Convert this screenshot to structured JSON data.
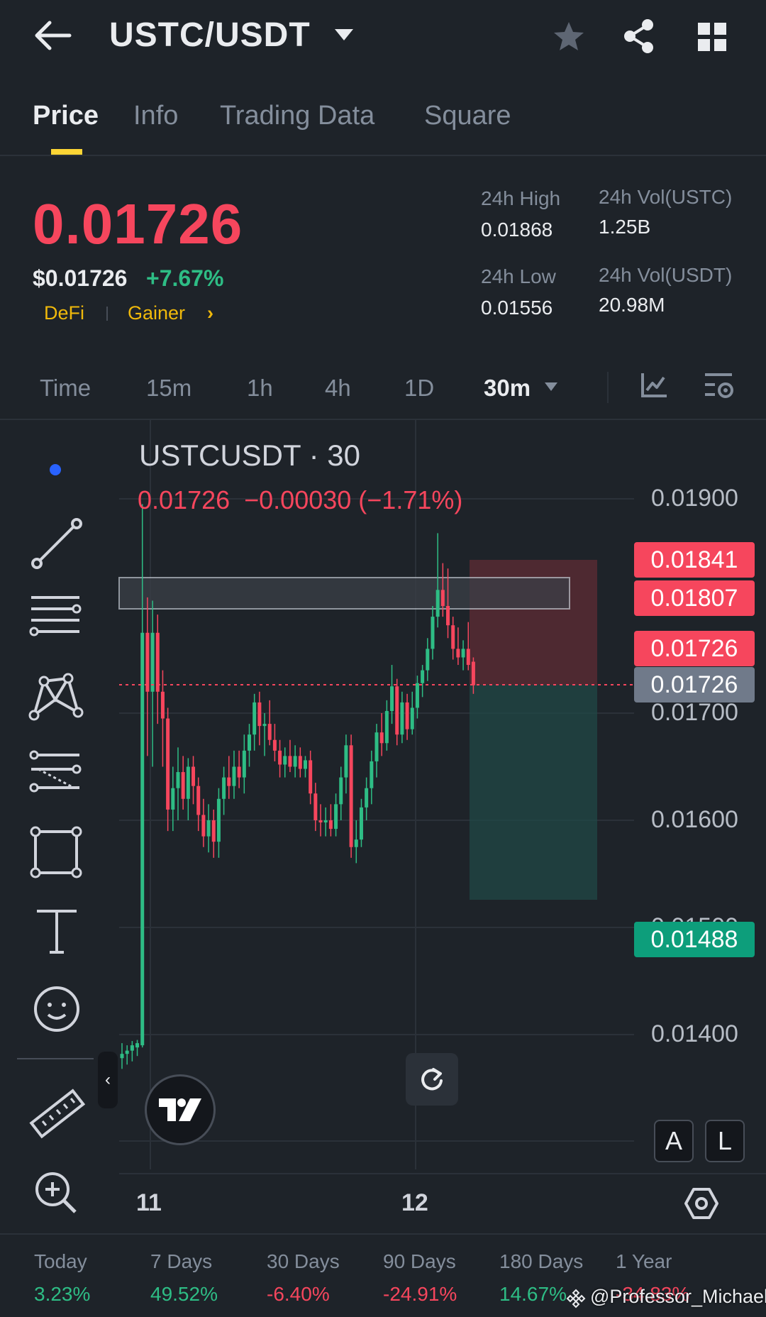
{
  "header": {
    "pair": "USTC/USDT",
    "icons": [
      "back-arrow-icon",
      "caret-down-icon",
      "star-icon",
      "share-icon",
      "grid-icon"
    ]
  },
  "tabs": [
    {
      "label": "Price",
      "active": true
    },
    {
      "label": "Info",
      "active": false
    },
    {
      "label": "Trading Data",
      "active": false
    },
    {
      "label": "Square",
      "active": false
    }
  ],
  "price": {
    "last": "0.01726",
    "usd": "$0.01726",
    "change": "+7.67%",
    "tags": [
      "DeFi",
      "Gainer"
    ],
    "gainer_chevron": "›"
  },
  "stats": {
    "high_label": "24h High",
    "high_value": "0.01868",
    "low_label": "24h Low",
    "low_value": "0.01556",
    "vol_base_label": "24h Vol(USTC)",
    "vol_base_value": "1.25B",
    "vol_quote_label": "24h Vol(USDT)",
    "vol_quote_value": "20.98M"
  },
  "intervals": [
    {
      "label": "Time",
      "active": false
    },
    {
      "label": "15m",
      "active": false
    },
    {
      "label": "1h",
      "active": false
    },
    {
      "label": "4h",
      "active": false
    },
    {
      "label": "1D",
      "active": false
    },
    {
      "label": "30m",
      "active": true
    }
  ],
  "chart": {
    "symbol_title": "USTCUSDT · 30",
    "ohlc_line": "0.01726  −0.00030 (−1.71%)",
    "axis_labels": [
      "0.01900",
      "0.01700",
      "0.01600",
      "0.01500",
      "0.01400"
    ],
    "price_tags": [
      {
        "value": "0.01841",
        "color": "#f6465d"
      },
      {
        "value": "0.01807",
        "color": "#f6465d"
      },
      {
        "value": "0.01726",
        "color": "#f6465d"
      },
      {
        "value": "0.01726",
        "color": "#707a8a"
      },
      {
        "value": "0.01488",
        "color": "#0d9e7b"
      }
    ],
    "dates": [
      "11",
      "12"
    ],
    "scale_buttons": [
      "A",
      "L"
    ],
    "collapse_glyph": "‹",
    "colors": {
      "up": "#2ebd85",
      "down": "#f6465d"
    }
  },
  "chart_data": {
    "type": "candlestick",
    "symbol": "USTCUSDT",
    "interval": "30",
    "y_axis_ticks": [
      0.019,
      0.017,
      0.016,
      0.015,
      0.014
    ],
    "ylim": [
      0.0133,
      0.0198
    ],
    "x_tick_labels": [
      "11",
      "12"
    ],
    "last_price": 0.01726,
    "change": -0.0003,
    "change_percent": -1.71,
    "position_tool": {
      "entry": 0.01726,
      "stop": 0.01841,
      "target": 0.01488
    },
    "marked_levels": [
      0.01841,
      0.01807,
      0.01726
    ],
    "candles": [
      {
        "o": 0.01378,
        "h": 0.01392,
        "l": 0.01368,
        "c": 0.01382
      },
      {
        "o": 0.01382,
        "h": 0.0139,
        "l": 0.01372,
        "c": 0.01385
      },
      {
        "o": 0.01385,
        "h": 0.01394,
        "l": 0.01375,
        "c": 0.0139
      },
      {
        "o": 0.01388,
        "h": 0.01395,
        "l": 0.0138,
        "c": 0.01392
      },
      {
        "o": 0.0139,
        "h": 0.01895,
        "l": 0.01388,
        "c": 0.01775
      },
      {
        "o": 0.01775,
        "h": 0.01808,
        "l": 0.0166,
        "c": 0.0172
      },
      {
        "o": 0.0172,
        "h": 0.01805,
        "l": 0.0165,
        "c": 0.01775
      },
      {
        "o": 0.01775,
        "h": 0.01792,
        "l": 0.0169,
        "c": 0.0172
      },
      {
        "o": 0.0172,
        "h": 0.0174,
        "l": 0.0165,
        "c": 0.01695
      },
      {
        "o": 0.01695,
        "h": 0.01705,
        "l": 0.0159,
        "c": 0.0161
      },
      {
        "o": 0.0161,
        "h": 0.0165,
        "l": 0.0159,
        "c": 0.0163
      },
      {
        "o": 0.0163,
        "h": 0.01668,
        "l": 0.016,
        "c": 0.01645
      },
      {
        "o": 0.01645,
        "h": 0.0166,
        "l": 0.0161,
        "c": 0.0162
      },
      {
        "o": 0.0162,
        "h": 0.01658,
        "l": 0.016,
        "c": 0.0165
      },
      {
        "o": 0.0165,
        "h": 0.0166,
        "l": 0.01615,
        "c": 0.01632
      },
      {
        "o": 0.01632,
        "h": 0.0164,
        "l": 0.0159,
        "c": 0.01605
      },
      {
        "o": 0.01605,
        "h": 0.0162,
        "l": 0.01575,
        "c": 0.01585
      },
      {
        "o": 0.01585,
        "h": 0.01615,
        "l": 0.0157,
        "c": 0.016
      },
      {
        "o": 0.016,
        "h": 0.0161,
        "l": 0.01565,
        "c": 0.0158
      },
      {
        "o": 0.0158,
        "h": 0.0163,
        "l": 0.01565,
        "c": 0.0162
      },
      {
        "o": 0.0162,
        "h": 0.0165,
        "l": 0.01605,
        "c": 0.0164
      },
      {
        "o": 0.0164,
        "h": 0.0166,
        "l": 0.0162,
        "c": 0.01632
      },
      {
        "o": 0.01632,
        "h": 0.01665,
        "l": 0.0162,
        "c": 0.0165
      },
      {
        "o": 0.0165,
        "h": 0.01665,
        "l": 0.0163,
        "c": 0.0164
      },
      {
        "o": 0.0164,
        "h": 0.0168,
        "l": 0.01625,
        "c": 0.01665
      },
      {
        "o": 0.01665,
        "h": 0.0169,
        "l": 0.0165,
        "c": 0.0168
      },
      {
        "o": 0.0168,
        "h": 0.01718,
        "l": 0.01665,
        "c": 0.0171
      },
      {
        "o": 0.0171,
        "h": 0.0172,
        "l": 0.0167,
        "c": 0.01688
      },
      {
        "o": 0.01688,
        "h": 0.017,
        "l": 0.0166,
        "c": 0.0169
      },
      {
        "o": 0.0169,
        "h": 0.01712,
        "l": 0.0167,
        "c": 0.01675
      },
      {
        "o": 0.01675,
        "h": 0.0169,
        "l": 0.01655,
        "c": 0.01665
      },
      {
        "o": 0.01665,
        "h": 0.01675,
        "l": 0.0164,
        "c": 0.01652
      },
      {
        "o": 0.01652,
        "h": 0.01668,
        "l": 0.0164,
        "c": 0.0166
      },
      {
        "o": 0.0166,
        "h": 0.01675,
        "l": 0.01645,
        "c": 0.0165
      },
      {
        "o": 0.0165,
        "h": 0.0167,
        "l": 0.0164,
        "c": 0.0166
      },
      {
        "o": 0.0166,
        "h": 0.01668,
        "l": 0.0164,
        "c": 0.01648
      },
      {
        "o": 0.01648,
        "h": 0.0166,
        "l": 0.0164,
        "c": 0.01656
      },
      {
        "o": 0.01656,
        "h": 0.01665,
        "l": 0.01615,
        "c": 0.01625
      },
      {
        "o": 0.01625,
        "h": 0.01635,
        "l": 0.0159,
        "c": 0.016
      },
      {
        "o": 0.016,
        "h": 0.01615,
        "l": 0.01585,
        "c": 0.01598
      },
      {
        "o": 0.01598,
        "h": 0.01612,
        "l": 0.01585,
        "c": 0.016
      },
      {
        "o": 0.016,
        "h": 0.01615,
        "l": 0.01585,
        "c": 0.01592
      },
      {
        "o": 0.01592,
        "h": 0.01625,
        "l": 0.01585,
        "c": 0.01615
      },
      {
        "o": 0.01615,
        "h": 0.0165,
        "l": 0.016,
        "c": 0.0164
      },
      {
        "o": 0.0164,
        "h": 0.0168,
        "l": 0.01625,
        "c": 0.0167
      },
      {
        "o": 0.0167,
        "h": 0.0168,
        "l": 0.01565,
        "c": 0.01575
      },
      {
        "o": 0.01575,
        "h": 0.016,
        "l": 0.0156,
        "c": 0.01582
      },
      {
        "o": 0.01582,
        "h": 0.0162,
        "l": 0.01575,
        "c": 0.01612
      },
      {
        "o": 0.01612,
        "h": 0.0164,
        "l": 0.016,
        "c": 0.0163
      },
      {
        "o": 0.0163,
        "h": 0.01665,
        "l": 0.01615,
        "c": 0.01655
      },
      {
        "o": 0.01655,
        "h": 0.0169,
        "l": 0.0164,
        "c": 0.01682
      },
      {
        "o": 0.01682,
        "h": 0.017,
        "l": 0.0166,
        "c": 0.01672
      },
      {
        "o": 0.01672,
        "h": 0.01712,
        "l": 0.01665,
        "c": 0.01702
      },
      {
        "o": 0.01702,
        "h": 0.01745,
        "l": 0.0169,
        "c": 0.01725
      },
      {
        "o": 0.01725,
        "h": 0.01732,
        "l": 0.0167,
        "c": 0.0168
      },
      {
        "o": 0.0168,
        "h": 0.0172,
        "l": 0.01672,
        "c": 0.0171
      },
      {
        "o": 0.0171,
        "h": 0.01718,
        "l": 0.01675,
        "c": 0.01685
      },
      {
        "o": 0.01685,
        "h": 0.0172,
        "l": 0.0168,
        "c": 0.01705
      },
      {
        "o": 0.01705,
        "h": 0.01735,
        "l": 0.01695,
        "c": 0.01728
      },
      {
        "o": 0.01728,
        "h": 0.01745,
        "l": 0.01715,
        "c": 0.0174
      },
      {
        "o": 0.0174,
        "h": 0.0177,
        "l": 0.0173,
        "c": 0.0176
      },
      {
        "o": 0.0176,
        "h": 0.018,
        "l": 0.0175,
        "c": 0.0179
      },
      {
        "o": 0.0179,
        "h": 0.01868,
        "l": 0.0178,
        "c": 0.01815
      },
      {
        "o": 0.01815,
        "h": 0.0184,
        "l": 0.0179,
        "c": 0.018
      },
      {
        "o": 0.018,
        "h": 0.01835,
        "l": 0.0177,
        "c": 0.01782
      },
      {
        "o": 0.01782,
        "h": 0.0179,
        "l": 0.0175,
        "c": 0.0176
      },
      {
        "o": 0.0176,
        "h": 0.0178,
        "l": 0.01745,
        "c": 0.01752
      },
      {
        "o": 0.01752,
        "h": 0.01768,
        "l": 0.0174,
        "c": 0.0176
      },
      {
        "o": 0.0176,
        "h": 0.01785,
        "l": 0.0174,
        "c": 0.01745
      },
      {
        "o": 0.01748,
        "h": 0.01752,
        "l": 0.01718,
        "c": 0.01726
      }
    ]
  },
  "performance": [
    {
      "label": "Today",
      "value": "3.23%",
      "color": "#2ebd85"
    },
    {
      "label": "7 Days",
      "value": "49.52%",
      "color": "#2ebd85"
    },
    {
      "label": "30 Days",
      "value": "-6.40%",
      "color": "#f6465d"
    },
    {
      "label": "90 Days",
      "value": "-24.91%",
      "color": "#f6465d"
    },
    {
      "label": "180 Days",
      "value": "14.67%",
      "color": "#2ebd85"
    },
    {
      "label": "1 Year",
      "value": "-34.83%",
      "color": "#f6465d"
    }
  ],
  "watermark": "@Professor_Michael"
}
